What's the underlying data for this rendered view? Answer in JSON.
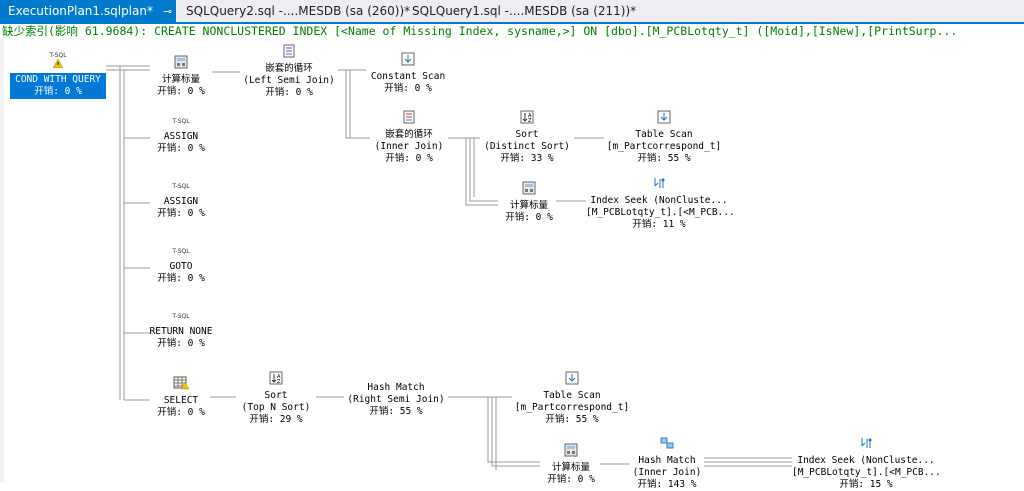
{
  "tabs": [
    {
      "label": "ExecutionPlan1.sqlplan*",
      "active": true,
      "pin": "⊸",
      "close": "✕"
    },
    {
      "label": "SQLQuery2.sql -....MESDB (sa (260))*",
      "active": false
    },
    {
      "label": "SQLQuery1.sql -....MESDB (sa (211))*",
      "active": false
    }
  ],
  "missing_index": "缺少索引(影响 61.9684): CREATE NONCLUSTERED INDEX [<Name of Missing Index, sysname,>] ON [dbo].[M_PCBLotqty_t] ([Moid],[IsNew],[PrintSurp...",
  "nodes": {
    "cond": {
      "tsql": "T-SQL",
      "label": "COND WITH QUERY",
      "cost": "开销: 0 %"
    },
    "compute1": {
      "label": "计算标量",
      "cost": "开销: 0 %"
    },
    "nested1": {
      "label": "嵌套的循环",
      "sub": "(Left Semi Join)",
      "cost": "开销: 0 %"
    },
    "constscan": {
      "label": "Constant Scan",
      "cost": "开销: 0 %"
    },
    "assign1": {
      "tsql": "T-SQL",
      "label": "ASSIGN",
      "cost": "开销: 0 %"
    },
    "nested2": {
      "label": "嵌套的循环",
      "sub": "(Inner Join)",
      "cost": "开销: 0 %"
    },
    "sort1": {
      "label": "Sort",
      "sub": "(Distinct Sort)",
      "cost": "开销: 33 %"
    },
    "tablescan1": {
      "label": "Table Scan",
      "sub": "[m_Partcorrespond_t]",
      "cost": "开销: 55 %"
    },
    "assign2": {
      "tsql": "T-SQL",
      "label": "ASSIGN",
      "cost": "开销: 0 %"
    },
    "compute2": {
      "label": "计算标量",
      "cost": "开销: 0 %"
    },
    "seek1": {
      "label": "Index Seek (NonCluste...",
      "sub": "[M_PCBLotqty_t].[<M_PCB...",
      "cost": "开销: 11 %"
    },
    "goto": {
      "tsql": "T-SQL",
      "label": "GOTO",
      "cost": "开销: 0 %"
    },
    "returnnone": {
      "tsql": "T-SQL",
      "label": "RETURN NONE",
      "cost": "开销: 0 %"
    },
    "select": {
      "label": "SELECT",
      "cost": "开销: 0 %"
    },
    "sort2": {
      "label": "Sort",
      "sub": "(Top N Sort)",
      "cost": "开销: 29 %"
    },
    "hash1": {
      "label": "Hash Match",
      "sub": "(Right Semi Join)",
      "cost": "开销: 55 %"
    },
    "tablescan2": {
      "label": "Table Scan",
      "sub": "[m_Partcorrespond_t]",
      "cost": "开销: 55 %"
    },
    "compute3": {
      "label": "计算标量",
      "cost": "开销: 0 %"
    },
    "hash2": {
      "label": "Hash Match",
      "sub": "(Inner Join)",
      "cost": "开销: 143 %"
    },
    "seek2": {
      "label": "Index Seek (NonCluste...",
      "sub": "[M_PCBLotqty_t].[<M_PCB...",
      "cost": "开销: 15 %"
    }
  },
  "colors": {
    "accent": "#007acc",
    "selected": "#0078d7",
    "missing_index_text": "#008000"
  }
}
